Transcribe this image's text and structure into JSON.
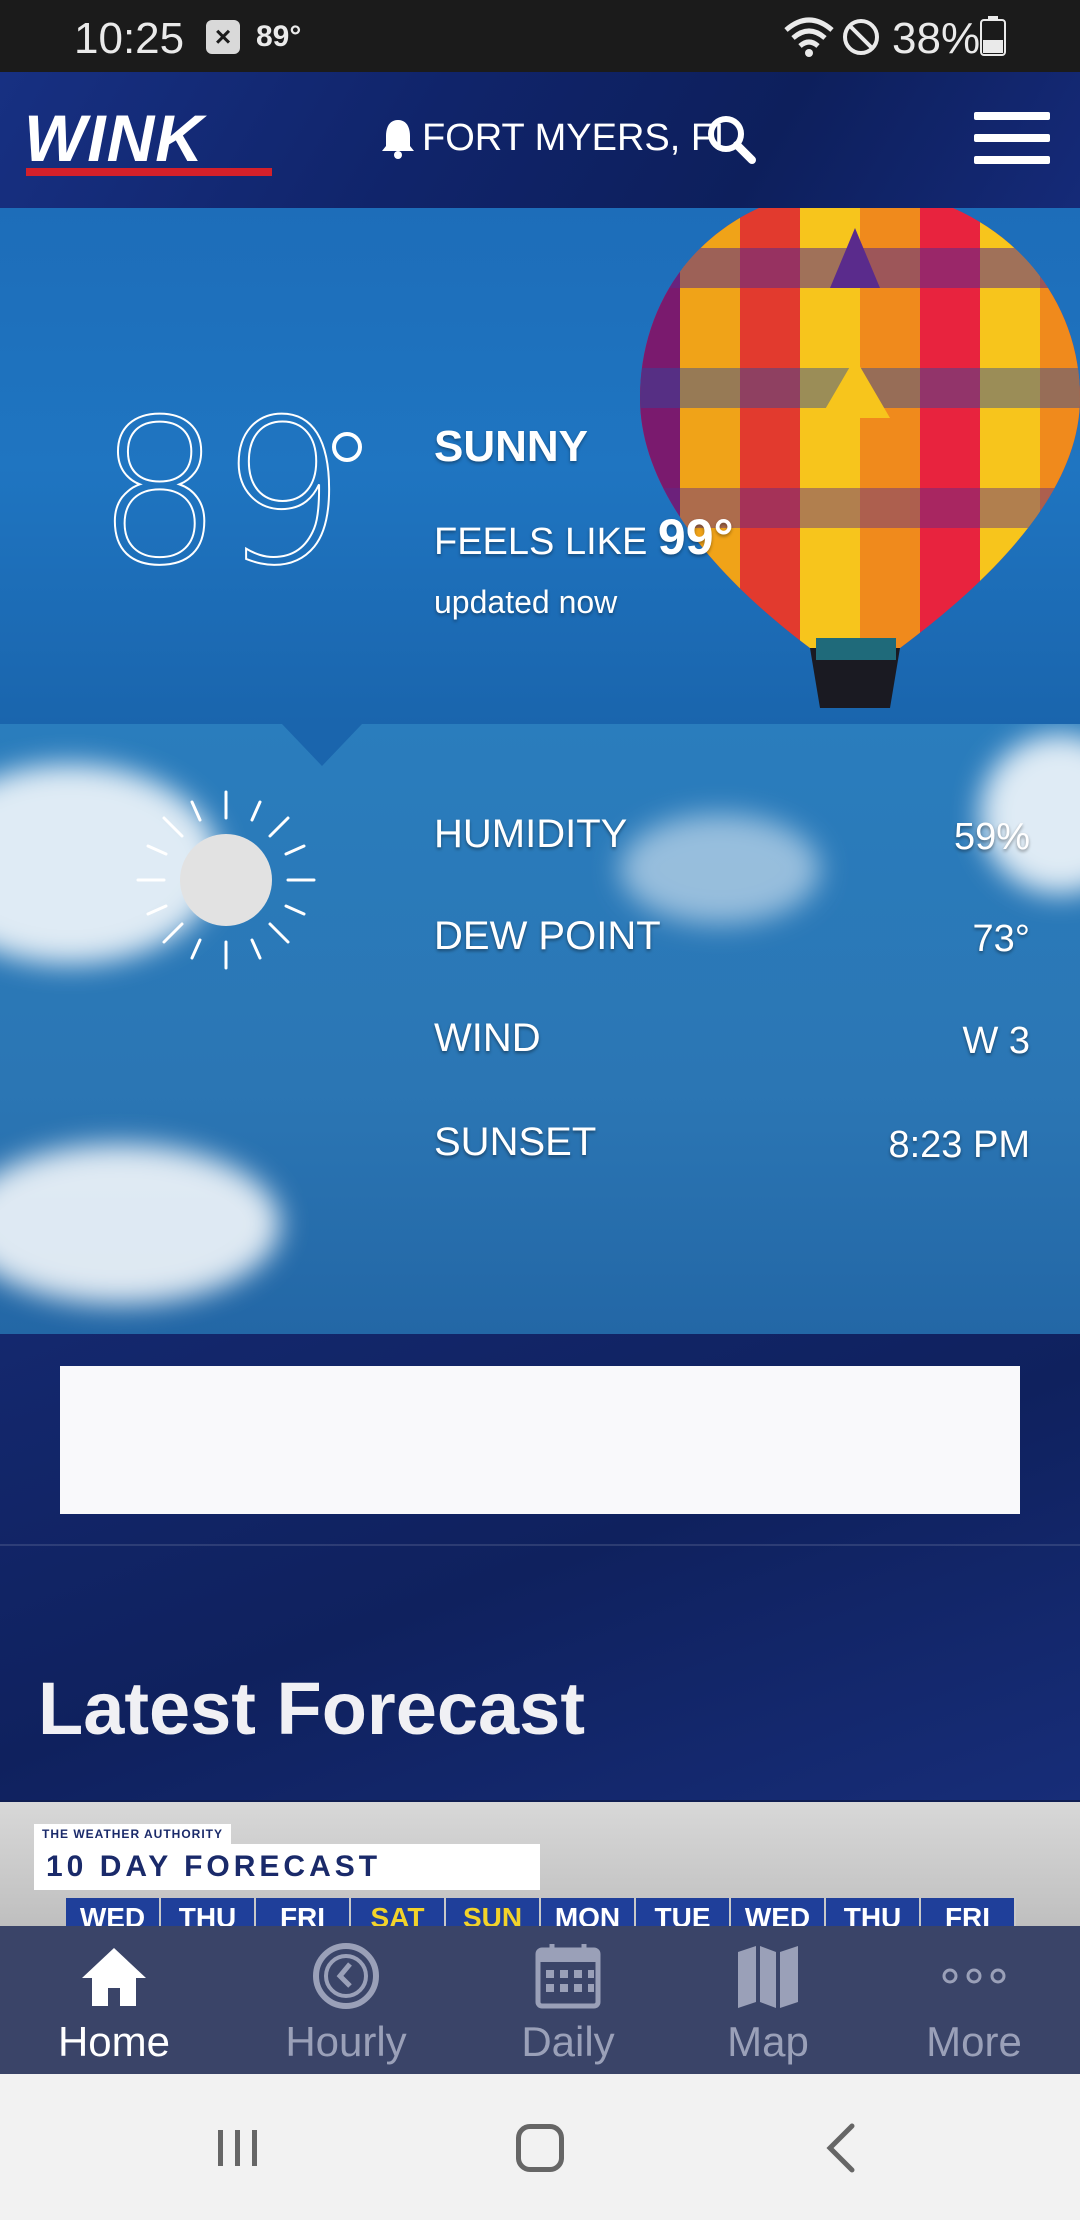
{
  "status_bar": {
    "time": "10:25",
    "notification_icon": "x-box-icon",
    "weather_temp": "89°",
    "battery_percent": "38%"
  },
  "header": {
    "logo_text": "WINK",
    "location": "FORT MYERS, FL"
  },
  "current": {
    "temperature": "89",
    "condition": "SUNNY",
    "feels_like_label": "FEELS LIKE",
    "feels_like_value": "99°",
    "updated": "updated now"
  },
  "details": [
    {
      "label": "HUMIDITY",
      "value": "59%"
    },
    {
      "label": "DEW POINT",
      "value": "73°"
    },
    {
      "label": "WIND",
      "value": "W 3"
    },
    {
      "label": "SUNSET",
      "value": "8:23 PM"
    }
  ],
  "latest_forecast": {
    "title": "Latest Forecast",
    "thumb_kicker": "THE WEATHER AUTHORITY",
    "thumb_title": "10 DAY FORECAST",
    "days": [
      "WED",
      "THU",
      "FRI",
      "SAT",
      "SUN",
      "MON",
      "TUE",
      "WED",
      "THU",
      "FRI"
    ]
  },
  "bottom_nav": [
    {
      "label": "Home",
      "icon": "home-icon",
      "active": true
    },
    {
      "label": "Hourly",
      "icon": "clock-icon",
      "active": false
    },
    {
      "label": "Daily",
      "icon": "calendar-icon",
      "active": false
    },
    {
      "label": "Map",
      "icon": "map-icon",
      "active": false
    },
    {
      "label": "More",
      "icon": "more-dots-icon",
      "active": false
    }
  ],
  "colors": {
    "header_bg": "#10246a",
    "hero_bg": "#1f75c1",
    "logo_underline": "#d4202a",
    "nav_bg": "#3a4468",
    "weekend_highlight": "#f2d32a"
  }
}
